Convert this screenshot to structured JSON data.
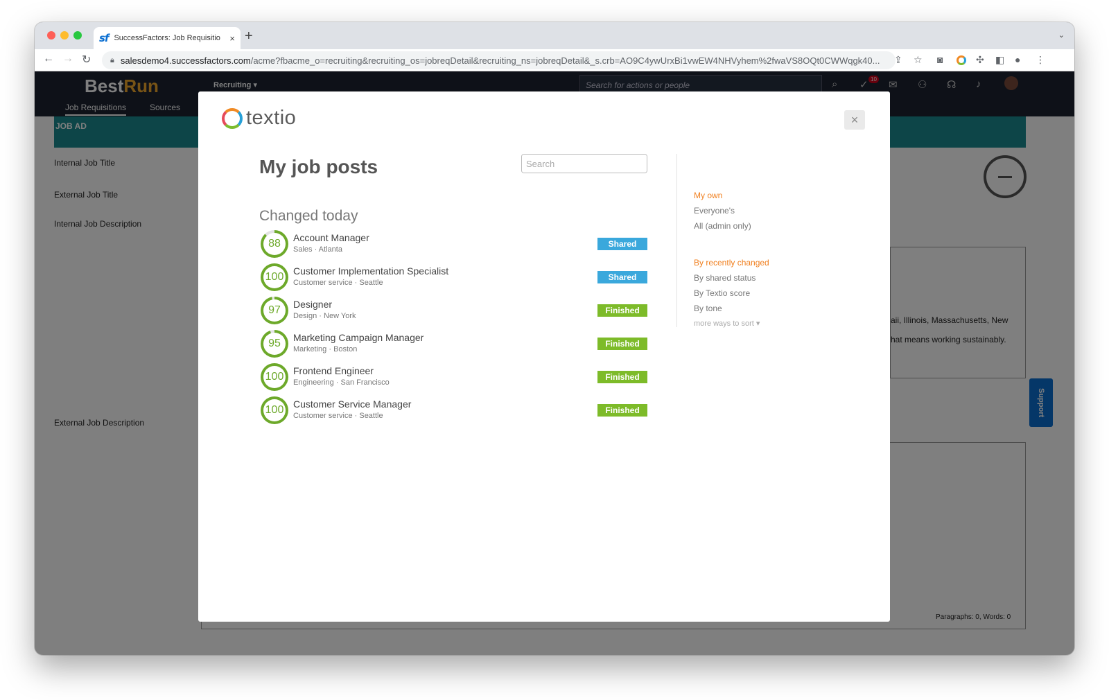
{
  "browser": {
    "tab_title": "SuccessFactors: Job Requisitio",
    "tab_close": "×",
    "new_tab": "+",
    "favicon": "sf",
    "url_host": "salesdemo4.successfactors.com",
    "url_path": "/acme?fbacme_o=recruiting&recruiting_os=jobreqDetail&recruiting_ns=jobreqDetail&_s.crb=AO9C4ywUrxBi1vwEW4NHVyhem%2fwaVS8OQt0CWWqgk40..."
  },
  "app": {
    "logo_best": "Best",
    "logo_run": "Run",
    "module_label": "Recruiting",
    "tabs": [
      "Job Requisitions",
      "Sources"
    ],
    "header_search_placeholder": "Search for actions or people",
    "notification_count": "10",
    "section_header": "JOB AD",
    "field_labels": [
      "Internal Job Title",
      "External Job Title",
      "Internal Job Description",
      "External Job Description"
    ],
    "bg_snippets": [
      "aii, Illinois, Massachusetts, New",
      "hat means working sustainably."
    ],
    "status_bar": "Paragraphs: 0, Words: 0",
    "support_label": "Support"
  },
  "modal": {
    "brand": "textio",
    "close_label": "×",
    "title": "My job posts",
    "search_placeholder": "Search",
    "section_title": "Changed today",
    "jobs": [
      {
        "score": "88",
        "title": "Account Manager",
        "subtitle": "Sales · Atlanta",
        "status": "Shared"
      },
      {
        "score": "100",
        "title": "Customer Implementation Specialist",
        "subtitle": "Customer service · Seattle",
        "status": "Shared"
      },
      {
        "score": "97",
        "title": "Designer",
        "subtitle": "Design · New York",
        "status": "Finished"
      },
      {
        "score": "95",
        "title": "Marketing Campaign Manager",
        "subtitle": "Marketing · Boston",
        "status": "Finished"
      },
      {
        "score": "100",
        "title": "Frontend Engineer",
        "subtitle": "Engineering · San Francisco",
        "status": "Finished"
      },
      {
        "score": "100",
        "title": "Customer Service Manager",
        "subtitle": "Customer service · Seattle",
        "status": "Finished"
      }
    ],
    "owner_filters": [
      "My own",
      "Everyone's",
      "All (admin only)"
    ],
    "sort_options": [
      "By recently changed",
      "By shared status",
      "By Textio score",
      "By tone"
    ],
    "more_sort": "more ways to sort",
    "colors": {
      "shared": "#3aa8dc",
      "finished": "#7dbb29",
      "active_filter": "#f07f1e",
      "score": "#6da92a"
    }
  }
}
